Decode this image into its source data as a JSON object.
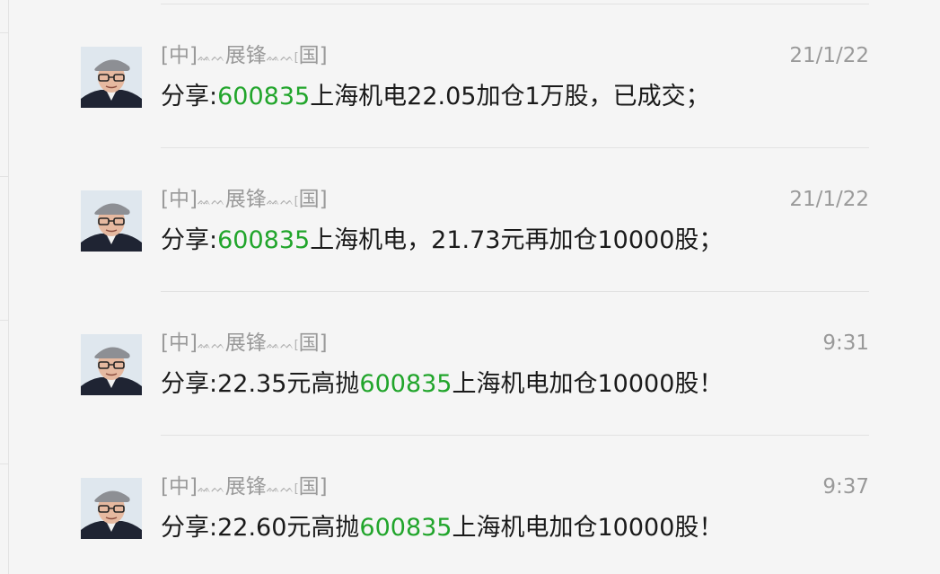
{
  "messages": [
    {
      "sender": {
        "pre": "[中]",
        "orn1": "ᨐᨓ",
        "mid": "展锋",
        "orn2": "ᨐᨓ",
        "small": "[",
        "post": "国]"
      },
      "time": "21/1/22",
      "parts": [
        "分享:",
        "600835",
        "上海机电22.05加仓1万股，已成交；"
      ]
    },
    {
      "sender": {
        "pre": "[中]",
        "orn1": "ᨐᨓ",
        "mid": "展锋",
        "orn2": "ᨐᨓ",
        "small": "[",
        "post": "国]"
      },
      "time": "21/1/22",
      "parts": [
        "分享:",
        "600835",
        "上海机电，21.73元再加仓10000股；"
      ]
    },
    {
      "sender": {
        "pre": "[中]",
        "orn1": "ᨐᨓ",
        "mid": "展锋",
        "orn2": "ᨐᨓ",
        "small": "[",
        "post": "国]"
      },
      "time": "9:31",
      "parts": [
        "分享:22.35元高抛",
        "600835",
        "上海机电加仓10000股！"
      ]
    },
    {
      "sender": {
        "pre": "[中]",
        "orn1": "ᨐᨓ",
        "mid": "展锋",
        "orn2": "ᨐᨓ",
        "small": "[",
        "post": "国]"
      },
      "time": "9:37",
      "parts": [
        "分享:22.60元高抛",
        "600835",
        "上海机电加仓10000股！"
      ]
    }
  ],
  "colors": {
    "background": "#f5f5f5",
    "stock_code": "#21a52b",
    "meta_text": "#9a9a9a",
    "body_text": "#1a1a1a",
    "divider": "#e2e2e2"
  },
  "icons": {
    "avatar": "user-avatar-photo"
  }
}
